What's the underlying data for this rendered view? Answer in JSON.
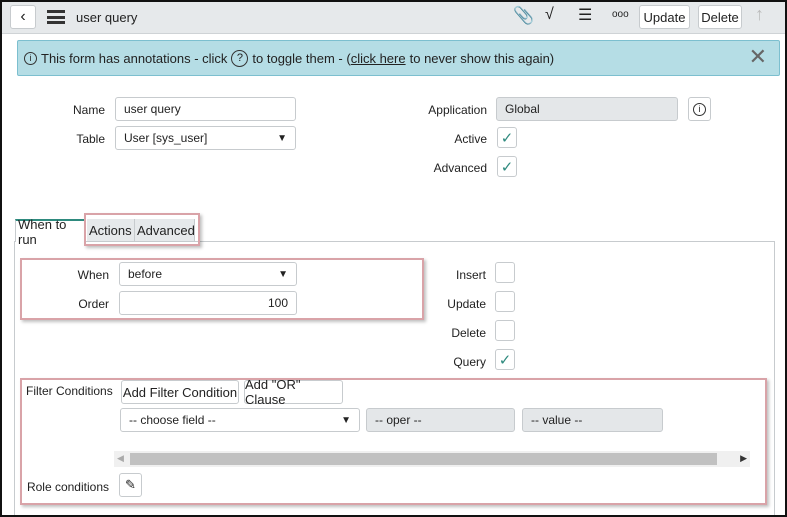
{
  "header": {
    "title": "user query",
    "update": "Update",
    "delete": "Delete"
  },
  "banner": {
    "text_before": "This form has annotations - click",
    "help_glyph": "?",
    "text_mid": "to toggle them - (",
    "link": "click here",
    "text_after": "to never show this again)"
  },
  "form": {
    "name_label": "Name",
    "name_value": "user query",
    "table_label": "Table",
    "table_value": "User [sys_user]",
    "application_label": "Application",
    "application_value": "Global",
    "active_label": "Active",
    "active": true,
    "advanced_label": "Advanced",
    "advanced": true
  },
  "tabs": [
    {
      "label": "When to run",
      "active": true
    },
    {
      "label": "Actions"
    },
    {
      "label": "Advanced"
    }
  ],
  "when_to_run": {
    "when_label": "When",
    "when_value": "before",
    "order_label": "Order",
    "order_value": "100",
    "insert_label": "Insert",
    "insert": false,
    "update_label": "Update",
    "update": false,
    "delete_label": "Delete",
    "delete": false,
    "query_label": "Query",
    "query": true
  },
  "filter": {
    "label": "Filter Conditions",
    "add_condition": "Add Filter Condition",
    "add_or": "Add \"OR\" Clause",
    "field_placeholder": "-- choose field --",
    "oper_placeholder": "-- oper --",
    "value_placeholder": "-- value --",
    "role_label": "Role conditions"
  },
  "colors": {
    "accent": "#2e8a7e",
    "banner": "#b5dde5"
  }
}
